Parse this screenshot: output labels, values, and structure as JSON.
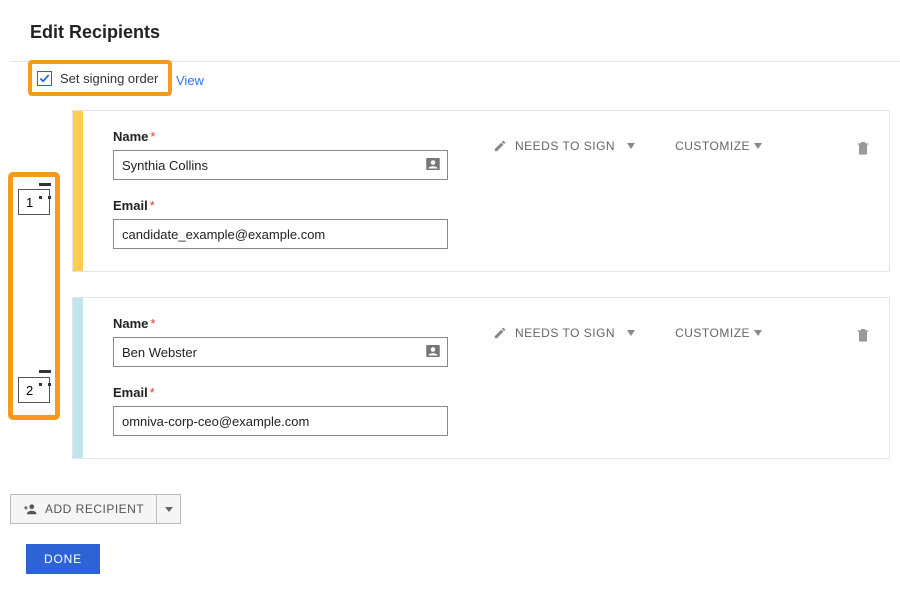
{
  "page_title": "Edit Recipients",
  "controls": {
    "set_signing_order_label": "Set signing order",
    "set_signing_order_checked": true,
    "view_link": "View"
  },
  "recipients": [
    {
      "order": "1",
      "name_label": "Name",
      "name_value": "Synthia Collins",
      "email_label": "Email",
      "email_value": "candidate_example@example.com",
      "action_label": "NEEDS TO SIGN",
      "customize_label": "CUSTOMIZE",
      "color": "yellow"
    },
    {
      "order": "2",
      "name_label": "Name",
      "name_value": "Ben Webster",
      "email_label": "Email",
      "email_value": "omniva-corp-ceo@example.com",
      "action_label": "NEEDS TO SIGN",
      "customize_label": "CUSTOMIZE",
      "color": "blue"
    }
  ],
  "footer": {
    "add_recipient_label": "ADD RECIPIENT",
    "done_label": "DONE"
  }
}
